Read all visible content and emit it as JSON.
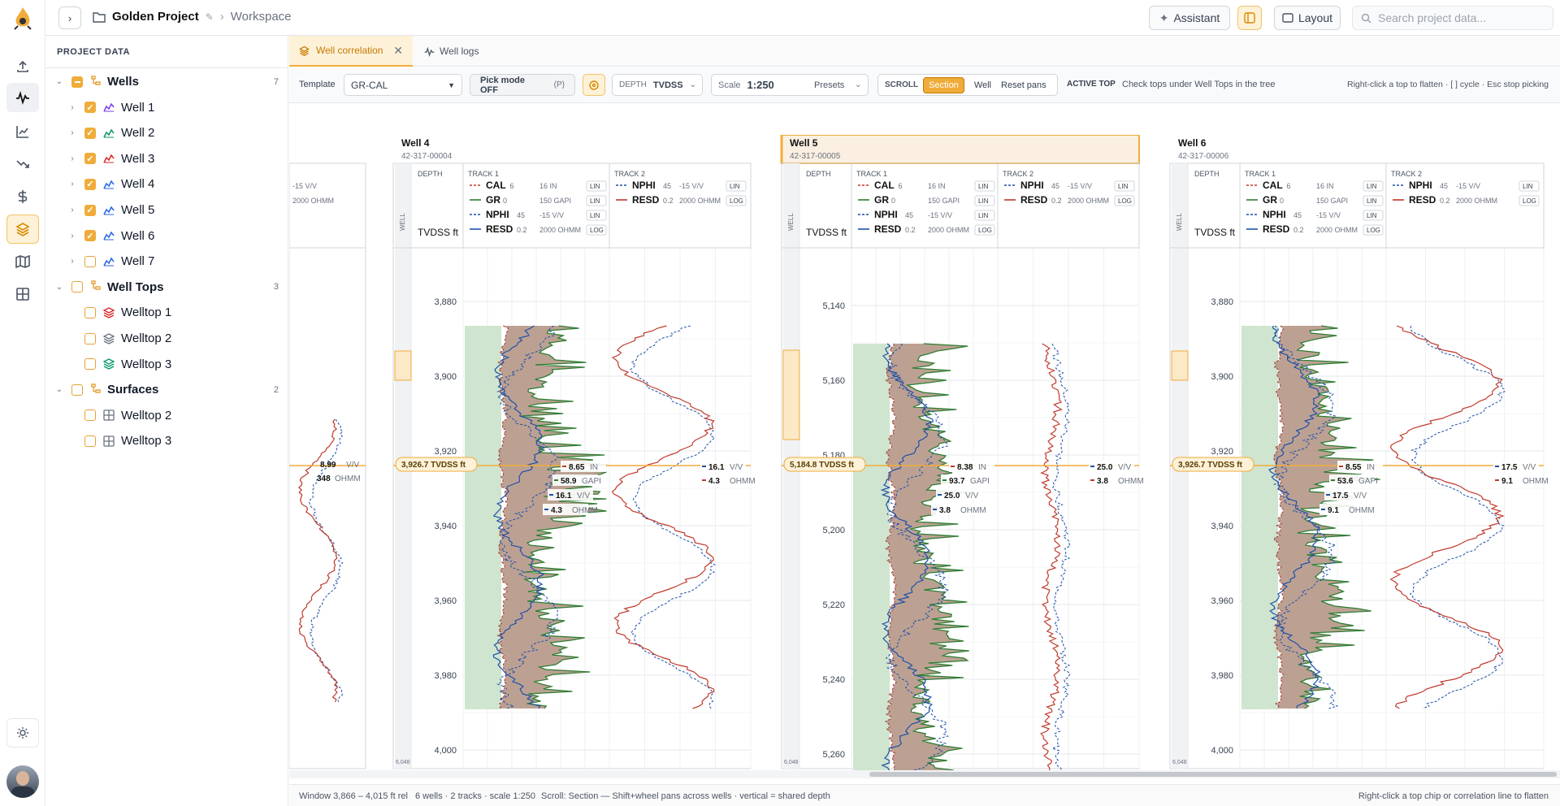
{
  "app": {
    "project": "Golden Project",
    "crumb": "Workspace",
    "assistant": "Assistant",
    "layout": "Layout",
    "search_placeholder": "Search project data..."
  },
  "sidebar": {
    "header": "PROJECT DATA",
    "groups": [
      {
        "label": "Wells",
        "count": "7",
        "items": [
          "Well 1",
          "Well 2",
          "Well 3",
          "Well 4",
          "Well 5",
          "Well 6",
          "Well 7"
        ],
        "checked": [
          true,
          true,
          true,
          true,
          true,
          true,
          false
        ]
      },
      {
        "label": "Well Tops",
        "count": "3",
        "items": [
          "Welltop 1",
          "Welltop 2",
          "Welltop 3"
        ]
      },
      {
        "label": "Surfaces",
        "count": "2",
        "items": [
          "Welltop 2",
          "Welltop 3"
        ]
      }
    ]
  },
  "tabs": [
    {
      "label": "Well correlation",
      "active": true
    },
    {
      "label": "Well logs",
      "active": false
    }
  ],
  "toolbar": {
    "template_label": "Template",
    "template_value": "GR-CAL",
    "pick_mode": "Pick mode OFF",
    "pick_key": "(P)",
    "depth_label": "DEPTH",
    "depth_value": "TVDSS",
    "scale_label": "Scale",
    "scale_value": "1:250",
    "presets": "Presets",
    "scroll_label": "SCROLL",
    "scroll_options": [
      "Section",
      "Well",
      "Reset pans"
    ],
    "active_top_label": "ACTIVE TOP",
    "active_top_hint": "Check tops under Well Tops in the tree",
    "right_hint": "Right-click a top to flatten · [ ] cycle · Esc stop picking"
  },
  "panel": {
    "depth_hdr": "DEPTH",
    "depth_unit": "TVDSS ft",
    "well_hdr": "WELL",
    "track1": "TRACK 1",
    "track2": "TRACK 2",
    "bottom_depth": "6,048",
    "curves": [
      {
        "name": "CAL",
        "min": "6",
        "max": "16 IN",
        "scale": "LIN",
        "color": "#c0392b",
        "dash": true
      },
      {
        "name": "GR",
        "min": "0",
        "max": "150 GAPI",
        "scale": "LIN",
        "color": "#2e7d32",
        "dash": false
      },
      {
        "name": "NPHI",
        "min": "45",
        "max": "-15 V/V",
        "scale": "LIN",
        "color": "#1e4fa8",
        "dash": true
      },
      {
        "name": "RESD",
        "min": "0.2",
        "max": "2000 OHMM",
        "scale": "LOG",
        "color": "#1e4fa8",
        "dash": false
      }
    ],
    "track2_curves": [
      {
        "name": "NPHI",
        "min": "45",
        "max": "-15 V/V",
        "scale": "LIN",
        "color": "#1e4fa8",
        "dash": true
      },
      {
        "name": "RESD",
        "min": "0.2",
        "max": "2000 OHMM",
        "scale": "LOG",
        "color": "#c0392b",
        "dash": false
      }
    ]
  },
  "wells": [
    {
      "name": "Well 4",
      "api": "42-317-00004",
      "ticks": [
        "3,880",
        "3,900",
        "3,920",
        "3,940",
        "3,960",
        "3,980",
        "4,000"
      ],
      "cursor": "3,926.7 TVDSS ft",
      "readouts": {
        "cal": "8.65",
        "cal_u": "IN",
        "gr": "58.9",
        "gr_u": "GAPI",
        "nphi": "16.1",
        "nphi_u": "V/V",
        "resd": "4.3",
        "resd_u": "OHMM",
        "t2_nphi": "16.1",
        "t2_resd": "4.3"
      }
    },
    {
      "name": "Well 5",
      "api": "42-317-00005",
      "ticks": [
        "5,140",
        "5,160",
        "5,180",
        "5,200",
        "5,220",
        "5,240",
        "5,260"
      ],
      "cursor": "5,184.8 TVDSS ft",
      "readouts": {
        "cal": "8.38",
        "cal_u": "IN",
        "gr": "93.7",
        "gr_u": "GAPI",
        "nphi": "25.0",
        "nphi_u": "V/V",
        "resd": "3.8",
        "resd_u": "OHMM",
        "t2_nphi": "25.0",
        "t2_resd": "3.8"
      }
    },
    {
      "name": "Well 6",
      "api": "42-317-00006",
      "ticks": [
        "3,880",
        "3,900",
        "3,920",
        "3,940",
        "3,960",
        "3,980",
        "4,000"
      ],
      "cursor": "3,926.7 TVDSS ft",
      "readouts": {
        "cal": "8.55",
        "cal_u": "IN",
        "gr": "53.6",
        "gr_u": "GAPI",
        "nphi": "17.5",
        "nphi_u": "V/V",
        "resd": "9.1",
        "resd_u": "OHMM",
        "t2_nphi": "17.5",
        "t2_resd": "9.1"
      }
    }
  ],
  "partial_well": {
    "nphi": "8.99",
    "nphi_u": "V/V",
    "resd": "348",
    "resd_u": "OHMM"
  },
  "status": {
    "window": "Window 3,866 – 4,015 ft rel",
    "summary": "6 wells · 2 tracks · scale 1:250",
    "scroll": "Scroll: Section — Shift+wheel pans across wells · vertical = shared depth",
    "right": "Right-click a top chip or correlation line to flatten"
  },
  "colors": {
    "accent": "#f0ac3a",
    "accent_dark": "#c87a00",
    "gr_fill": "#b09080",
    "clean_fill": "#cfe5cf"
  }
}
